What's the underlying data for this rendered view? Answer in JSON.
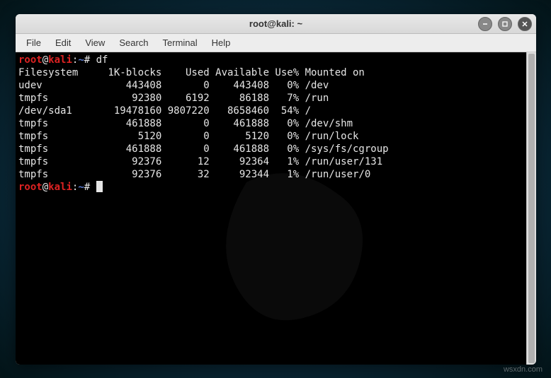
{
  "window": {
    "title": "root@kali: ~"
  },
  "menubar": {
    "items": [
      "File",
      "Edit",
      "View",
      "Search",
      "Terminal",
      "Help"
    ]
  },
  "prompt": {
    "user": "root",
    "at": "@",
    "host": "kali",
    "colon": ":",
    "path": "~",
    "symbol": "#"
  },
  "command1": "df",
  "output": {
    "header": "Filesystem     1K-blocks    Used Available Use% Mounted on",
    "rows": [
      "udev              443408       0    443408   0% /dev",
      "tmpfs              92380    6192     86188   7% /run",
      "/dev/sda1       19478160 9807220   8658460  54% /",
      "tmpfs             461888       0    461888   0% /dev/shm",
      "tmpfs               5120       0      5120   0% /run/lock",
      "tmpfs             461888       0    461888   0% /sys/fs/cgroup",
      "tmpfs              92376      12     92364   1% /run/user/131",
      "tmpfs              92376      32     92344   1% /run/user/0"
    ]
  },
  "watermark": "wsxdn.com"
}
